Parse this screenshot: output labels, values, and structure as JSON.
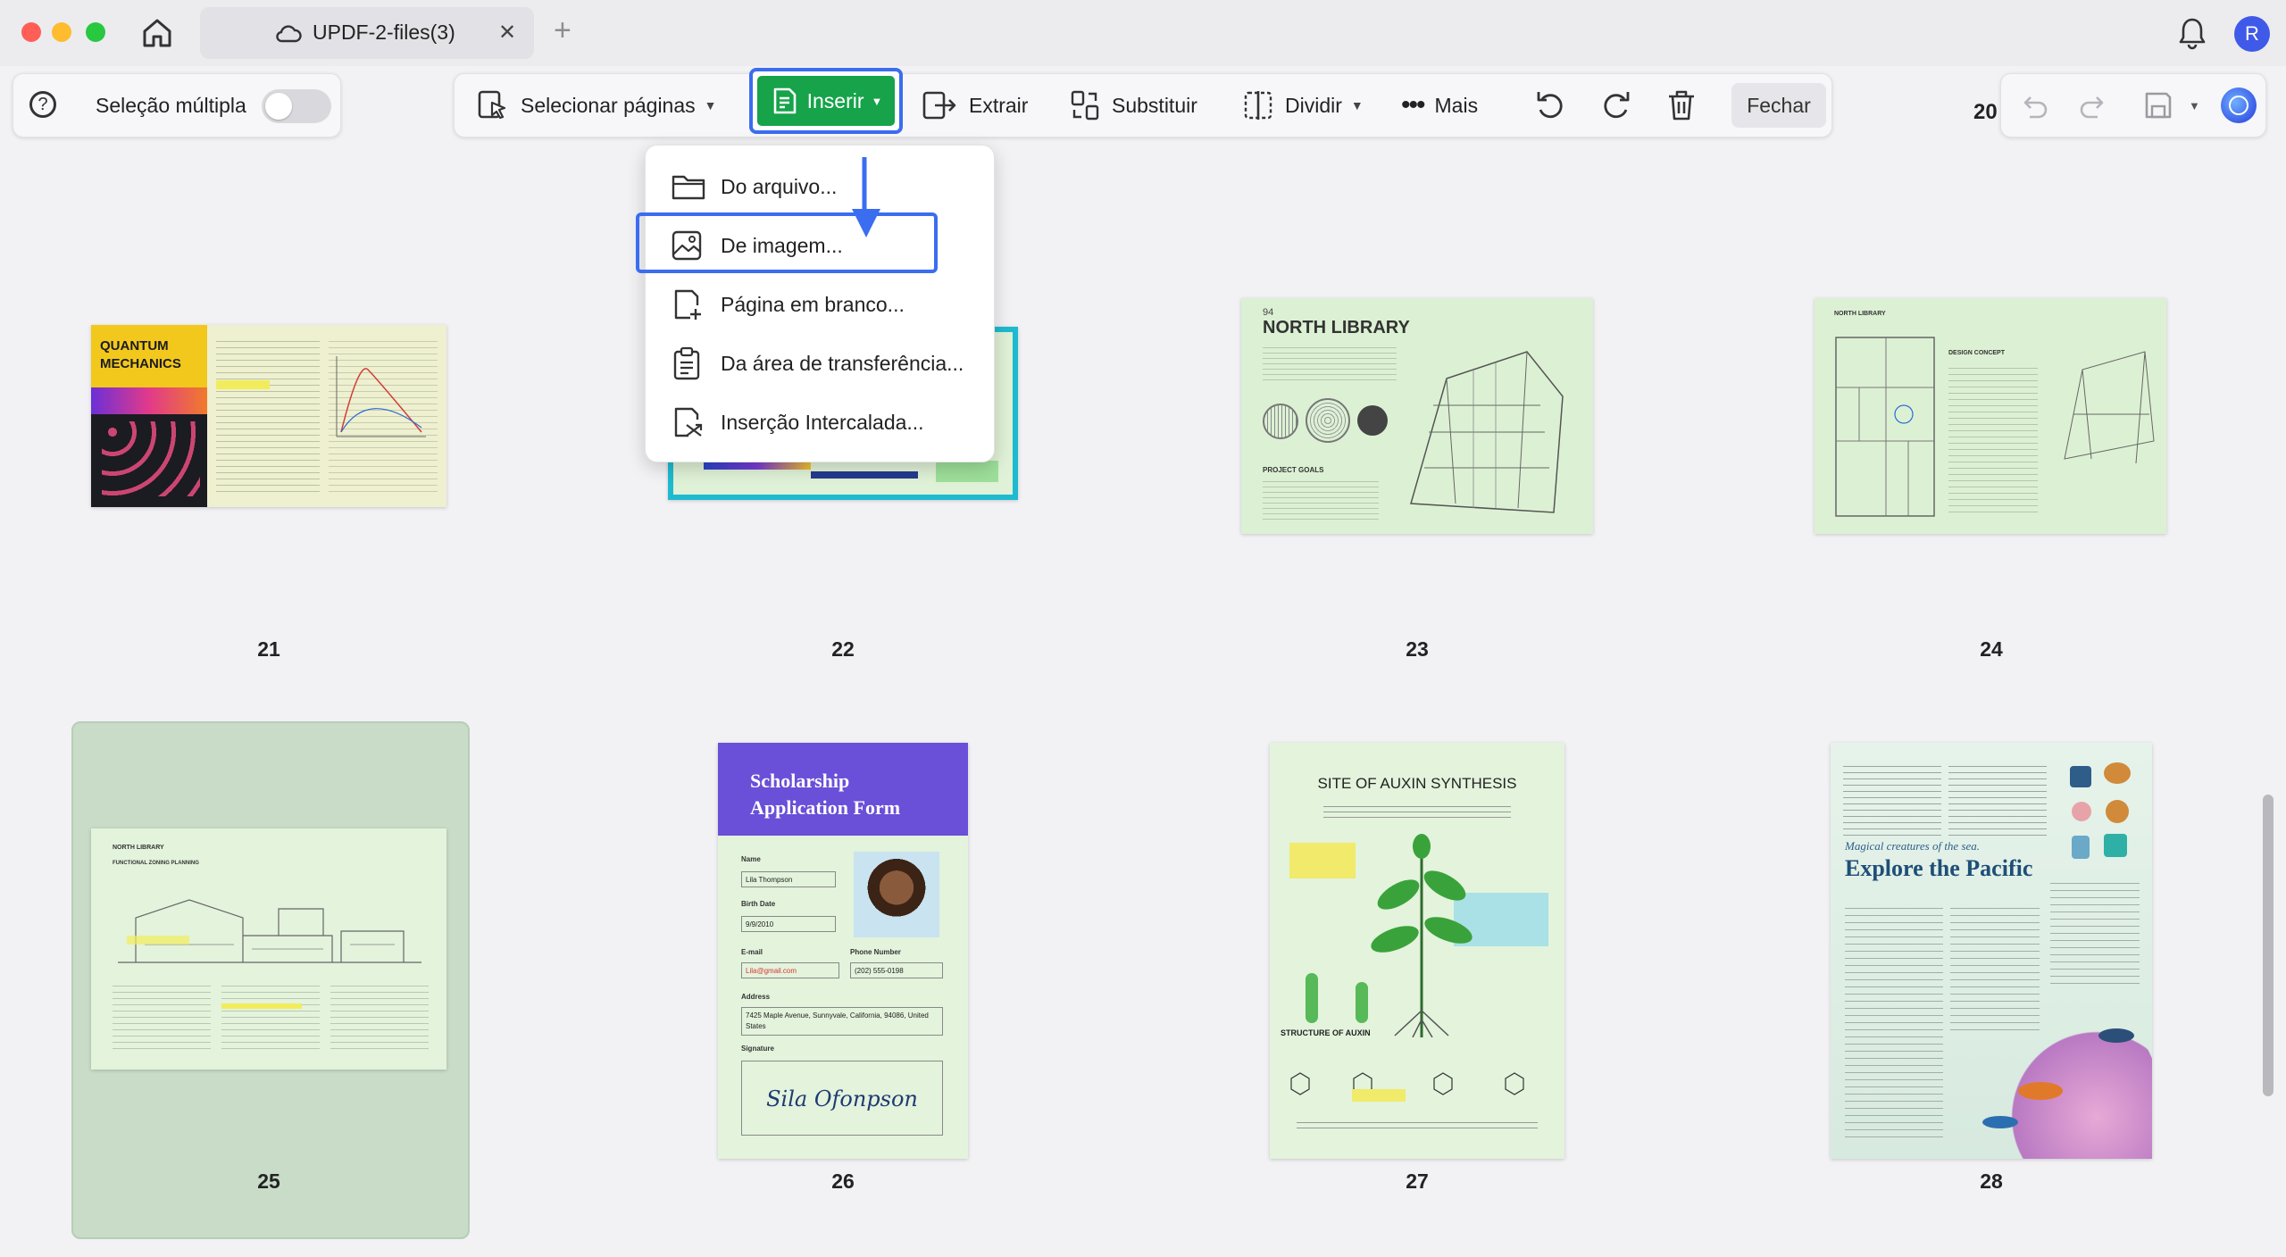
{
  "window": {
    "tab_title": "UPDF-2-files(3)",
    "avatar_initial": "R"
  },
  "toolbar_left": {
    "multi_select_label": "Seleção múltipla",
    "multi_select_on": false
  },
  "toolbar": {
    "select_pages_label": "Selecionar páginas",
    "insert_label": "Inserir",
    "extract_label": "Extrair",
    "replace_label": "Substituir",
    "split_label": "Dividir",
    "more_label": "Mais",
    "close_label": "Fechar"
  },
  "page_indicator_clipped": "20",
  "insert_menu": {
    "items": [
      {
        "label": "Do arquivo...",
        "icon": "folder-icon"
      },
      {
        "label": "De imagem...",
        "icon": "image-icon"
      },
      {
        "label": "Página em branco...",
        "icon": "blank-page-icon"
      },
      {
        "label": "Da área de transferência...",
        "icon": "clipboard-icon"
      },
      {
        "label": "Inserção Intercalada...",
        "icon": "interleave-icon"
      }
    ]
  },
  "pages": [
    {
      "number": "21",
      "title": "QUANTUM MECHANICS"
    },
    {
      "number": "22",
      "title": ""
    },
    {
      "number": "23",
      "title": "NORTH LIBRARY",
      "page_no": "94",
      "section": "PROJECT GOALS"
    },
    {
      "number": "24",
      "title": "NORTH LIBRARY",
      "section": "DESIGN CONCEPT"
    },
    {
      "number": "25",
      "title": "NORTH LIBRARY",
      "subtitle": "FUNCTIONAL ZONING PLANNING",
      "selected": true
    },
    {
      "number": "26",
      "title": "Scholarship Application Form",
      "fields": {
        "name_label": "Name",
        "name": "Lila Thompson",
        "birth_label": "Birth Date",
        "birth": "9/9/2010",
        "email_label": "E-mail",
        "email": "Lila@gmail.com",
        "phone_label": "Phone Number",
        "phone": "(202) 555-0198",
        "address_label": "Address",
        "address": "7425 Maple Avenue, Sunnyvale, California, 94086, United States",
        "signature_label": "Signature",
        "signature": "Sila Ofonpson"
      }
    },
    {
      "number": "27",
      "title": "SITE OF AUXIN SYNTHESIS",
      "section": "STRUCTURE OF AUXIN"
    },
    {
      "number": "28",
      "title": "Explore the Pacific",
      "subtitle": "Magical creatures of the sea."
    }
  ],
  "colors": {
    "accent_blue": "#3b6df0",
    "insert_green": "#16a34a",
    "selected_card": "#c8dcc8"
  }
}
